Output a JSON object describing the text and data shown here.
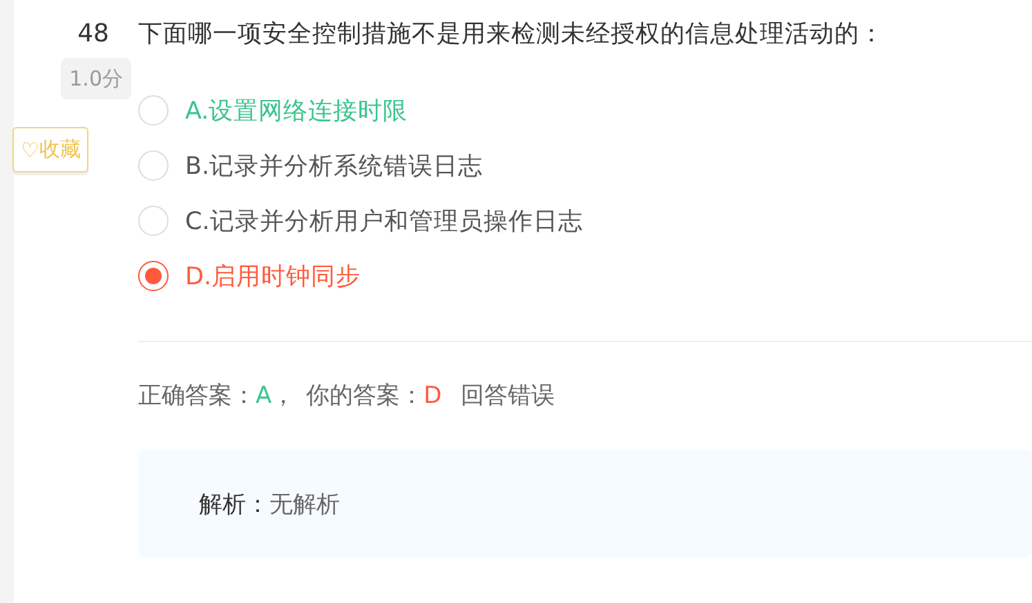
{
  "question": {
    "number": "48",
    "score": "1.0分",
    "favorite": {
      "icon": "♡",
      "label": "收藏"
    },
    "text": "下面哪一项安全控制措施不是用来检测未经授权的信息处理活动的：",
    "options": [
      {
        "label": "A.设置网络连接时限",
        "selected": false,
        "correct": true
      },
      {
        "label": "B.记录并分析系统错误日志",
        "selected": false,
        "correct": false
      },
      {
        "label": "C.记录并分析用户和管理员操作日志",
        "selected": false,
        "correct": false
      },
      {
        "label": "D.启用时钟同步",
        "selected": true,
        "correct": false
      }
    ]
  },
  "result": {
    "correct_label": "正确答案：",
    "correct_value": "A",
    "separator": "，",
    "your_label": "你的答案：",
    "your_value": "D",
    "verdict": "回答错误"
  },
  "analysis": {
    "label": "解析：",
    "text": "无解析"
  }
}
